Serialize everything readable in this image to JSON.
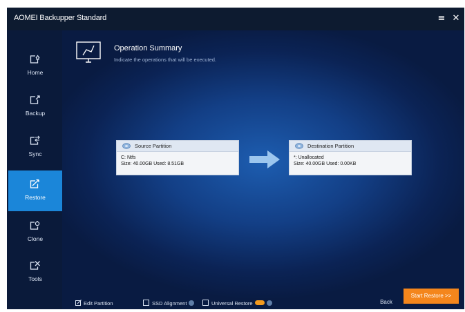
{
  "app": {
    "title": "AOMEI Backupper Standard",
    "menu_icon": "menu-icon",
    "close_icon": "close-icon"
  },
  "sidebar": {
    "items": [
      {
        "label": "Home",
        "icon": "home-icon",
        "active": false
      },
      {
        "label": "Backup",
        "icon": "backup-icon",
        "active": false
      },
      {
        "label": "Sync",
        "icon": "sync-icon",
        "active": false
      },
      {
        "label": "Restore",
        "icon": "restore-icon",
        "active": true
      },
      {
        "label": "Clone",
        "icon": "clone-icon",
        "active": false
      },
      {
        "label": "Tools",
        "icon": "tools-icon",
        "active": false
      }
    ]
  },
  "summary": {
    "title": "Operation Summary",
    "subtitle": "Indicate the operations that will be executed.",
    "icon": "summary-monitor-icon"
  },
  "source": {
    "header": "Source Partition",
    "line1": "C: Ntfs",
    "line2": "Size: 40.00GB  Used: 8.51GB"
  },
  "destination": {
    "header": "Destination Partition",
    "line1": "*: Unallocated",
    "line2": "Size: 40.00GB  Used: 0.00KB"
  },
  "footer": {
    "edit_partition": "Edit Partition",
    "ssd_alignment": "SSD Alignment",
    "universal_restore": "Universal Restore",
    "back": "Back",
    "start_restore": "Start Restore >>"
  },
  "colors": {
    "accent": "#1b86d9",
    "start_button": "#f4861c",
    "pro_badge": "#f39a1e"
  }
}
